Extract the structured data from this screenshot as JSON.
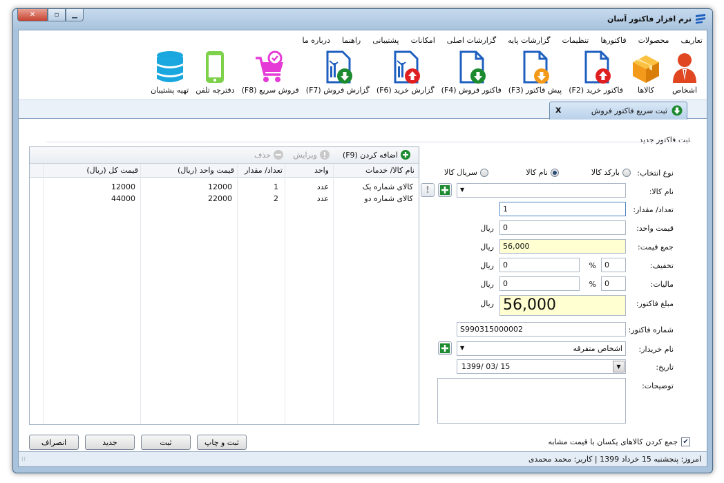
{
  "window": {
    "title": "نرم افزار فاکتور آسان"
  },
  "menu": [
    "تعاریف",
    "محصولات",
    "فاکتورها",
    "تنظیمات",
    "گزارشات پایه",
    "گزارشات اصلی",
    "امکانات",
    "پشتیبانی",
    "راهنما",
    "درباره ما"
  ],
  "toolbar": [
    {
      "label": "اشخاص",
      "icon": "person-icon"
    },
    {
      "label": "کالاها",
      "icon": "box-icon"
    },
    {
      "label": "فاکتور خرید (F2)",
      "icon": "purchase-invoice-icon"
    },
    {
      "label": "پیش فاکتور (F3)",
      "icon": "proforma-icon"
    },
    {
      "label": "فاکتور فروش (F4)",
      "icon": "sales-invoice-icon"
    },
    {
      "label": "گزارش خرید (F6)",
      "icon": "purchase-report-icon"
    },
    {
      "label": "گزارش فروش (F7)",
      "icon": "sales-report-icon"
    },
    {
      "label": "فروش سریع (F8)",
      "icon": "cart-icon"
    },
    {
      "label": "دفترچه تلفن",
      "icon": "phone-icon"
    },
    {
      "label": "تهیه پشتیبان",
      "icon": "database-icon"
    }
  ],
  "tab": {
    "label": "ثبت سریع فاکتور فروش",
    "close": "x"
  },
  "form": {
    "group_title": "ثبت فاکتور جدید",
    "select_type_label": "نوع انتخاب:",
    "radio_barcode": "بارکد کالا",
    "radio_name": "نام کالا",
    "radio_serial": "سریال کالا",
    "product_name_label": "نام کالا:",
    "qty_label": "تعداد/ مقدار:",
    "qty_value": "1",
    "unit_price_label": "قیمت واحد:",
    "unit_price_value": "0",
    "total_label": "جمع قیمت:",
    "total_value": "56,000",
    "discount_label": "تخفیف:",
    "discount_pct": "0",
    "discount_value": "0",
    "tax_label": "مالیات:",
    "tax_pct": "0",
    "tax_value": "0",
    "invoice_amount_label": "مبلغ فاکتور:",
    "invoice_amount_value": "56,000",
    "currency": "ریال",
    "percent": "%",
    "invoice_no_label": "شماره فاکتور:",
    "invoice_no_value": "S990315000002",
    "buyer_label": "نام خریدار:",
    "buyer_value": "اشخاص متفرقه",
    "date_label": "تاریخ:",
    "date_value": "1399/ 03/ 15",
    "notes_label": "توضیحات:"
  },
  "grid_toolbar": {
    "add": "اضافه کردن (F9)",
    "edit": "ویرایش",
    "delete": "حذف"
  },
  "grid": {
    "headers": [
      "نام کالا/ خدمات",
      "واحد",
      "تعداد/ مقدار",
      "قیمت واحد (ریال)",
      "قیمت کل (ریال)"
    ],
    "rows": [
      [
        "کالای شماره یک",
        "عدد",
        "1",
        "12000",
        "12000"
      ],
      [
        "کالای شماره دو",
        "عدد",
        "2",
        "22000",
        "44000"
      ]
    ]
  },
  "footer": {
    "merge_checkbox": "جمع کردن کالاهای یکسان با قیمت مشابه",
    "btn_save_print": "ثبت و چاپ",
    "btn_save": "ثبت",
    "btn_new": "جدید",
    "btn_cancel": "انصراف"
  },
  "status": {
    "text": "امروز: پنجشنبه 15 خرداد 1399  |  کاربر: محمد محمدی"
  },
  "colors": {
    "accent_blue": "#1f5fbf",
    "green": "#1c8a2e",
    "red": "#e02020",
    "orange": "#f39a1b",
    "magenta": "#e53ad6",
    "cyan": "#1aa7e0",
    "yellow_field": "#ffffd2"
  }
}
